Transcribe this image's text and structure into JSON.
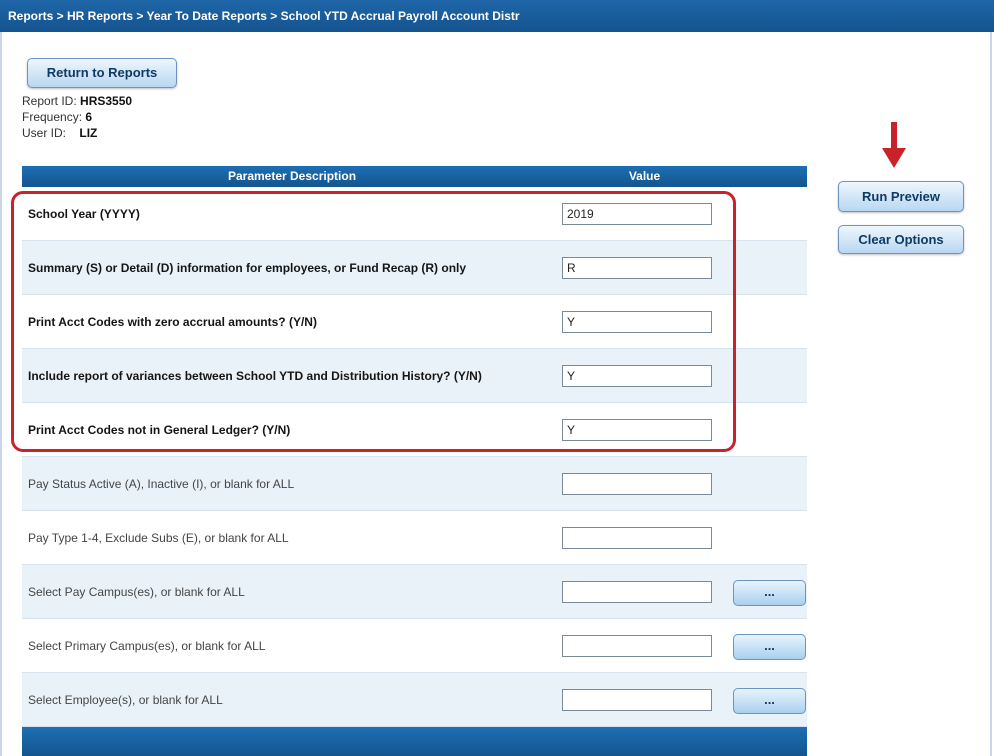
{
  "breadcrumb": "Reports > HR Reports > Year To Date Reports > School YTD Accrual Payroll Account Distr",
  "buttons": {
    "return": "Return to Reports",
    "run_preview": "Run Preview",
    "clear_options": "Clear Options",
    "lookup": "..."
  },
  "report_info": {
    "report_id_label": "Report ID:",
    "report_id": "HRS3550",
    "frequency_label": "Frequency:",
    "frequency": "6",
    "user_id_label": "User ID:",
    "user_id": "LIZ"
  },
  "table": {
    "header_description": "Parameter Description",
    "header_value": "Value"
  },
  "parameters": [
    {
      "label": "School Year (YYYY)",
      "value": "2019"
    },
    {
      "label": "Summary (S) or Detail (D) information for employees, or Fund Recap (R) only",
      "value": "R"
    },
    {
      "label": "Print Acct Codes with zero accrual amounts? (Y/N)",
      "value": "Y"
    },
    {
      "label": "Include report of variances between School YTD and Distribution History? (Y/N)",
      "value": "Y"
    },
    {
      "label": "Print Acct Codes not in General Ledger? (Y/N)",
      "value": "Y"
    },
    {
      "label": "Pay Status Active (A), Inactive (I), or blank for ALL",
      "value": ""
    },
    {
      "label": "Pay Type 1-4, Exclude Subs (E), or blank for ALL",
      "value": ""
    },
    {
      "label": "Select Pay Campus(es), or blank for ALL",
      "value": ""
    },
    {
      "label": "Select Primary Campus(es), or blank for ALL",
      "value": ""
    },
    {
      "label": "Select Employee(s), or blank for ALL",
      "value": ""
    }
  ],
  "annotation_color": "#c8232a"
}
